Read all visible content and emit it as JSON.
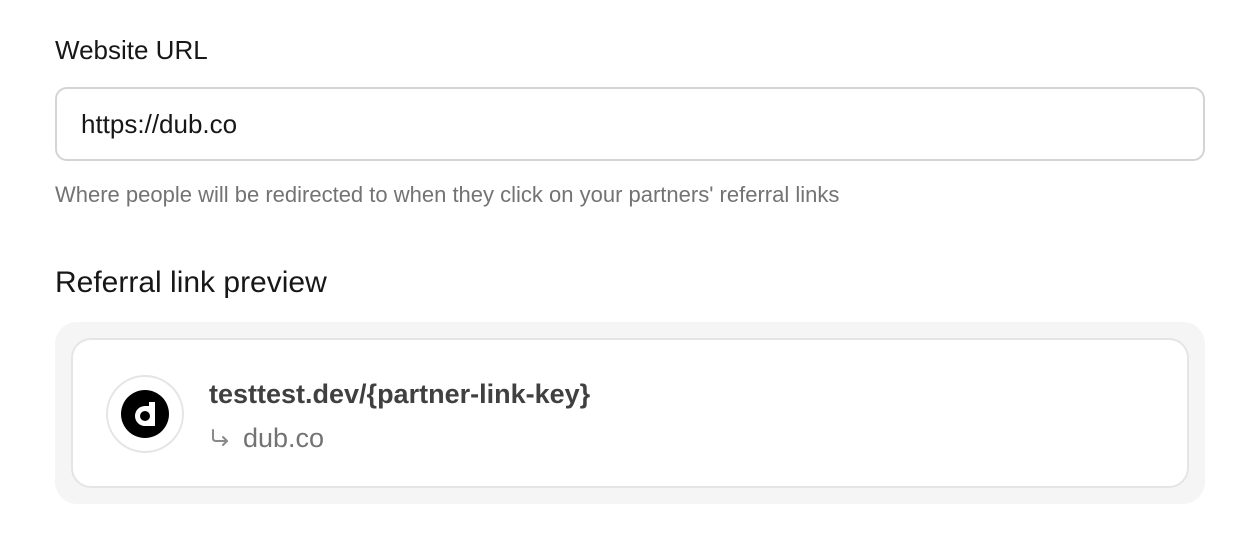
{
  "website_url": {
    "label": "Website URL",
    "value": "https://dub.co",
    "help_text": "Where people will be redirected to when they click on your partners' referral links"
  },
  "referral_preview": {
    "title": "Referral link preview",
    "short_link": "testtest.dev/{partner-link-key}",
    "destination": "dub.co",
    "logo_icon": "dub-logo-icon",
    "redirect_icon": "corner-down-right-arrow-icon"
  },
  "colors": {
    "text_primary": "#171717",
    "text_secondary": "#737373",
    "border": "#d4d4d4",
    "preview_bg": "#f5f5f5"
  }
}
